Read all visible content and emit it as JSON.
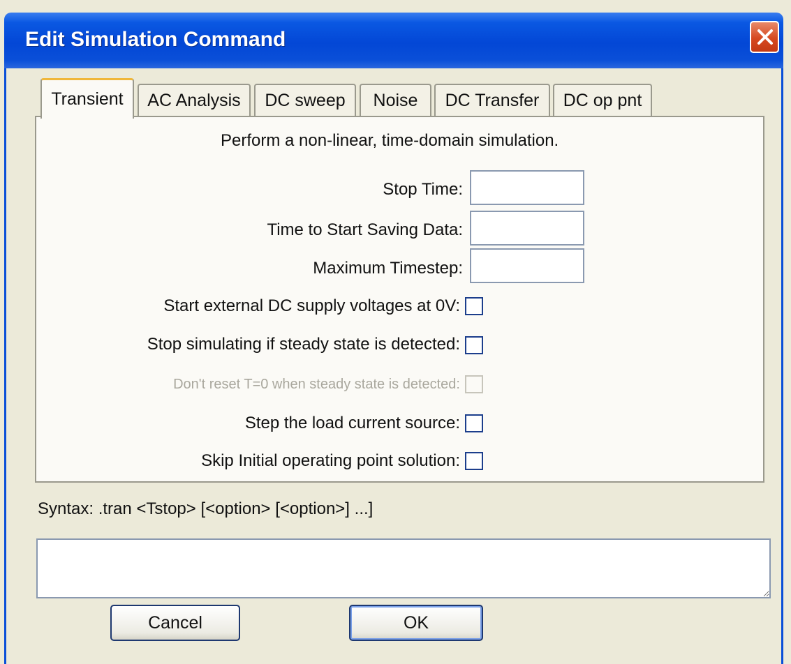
{
  "window": {
    "title": "Edit Simulation Command",
    "close_icon": "close-icon"
  },
  "tabs": [
    {
      "label": "Transient",
      "active": true
    },
    {
      "label": "AC Analysis",
      "active": false
    },
    {
      "label": "DC sweep",
      "active": false
    },
    {
      "label": "Noise",
      "active": false
    },
    {
      "label": "DC Transfer",
      "active": false
    },
    {
      "label": "DC op pnt",
      "active": false
    }
  ],
  "transient": {
    "description": "Perform a non-linear, time-domain simulation.",
    "fields": [
      {
        "label": "Stop Time:",
        "value": ""
      },
      {
        "label": "Time to Start Saving Data:",
        "value": ""
      },
      {
        "label": "Maximum Timestep:",
        "value": ""
      }
    ],
    "checkboxes": [
      {
        "label": "Start external DC supply voltages at 0V:",
        "checked": false,
        "enabled": true
      },
      {
        "label": "Stop simulating if steady state is detected:",
        "checked": false,
        "enabled": true
      },
      {
        "label": "Don't reset T=0 when steady state is detected:",
        "checked": false,
        "enabled": false
      },
      {
        "label": "Step the load current source:",
        "checked": false,
        "enabled": true
      },
      {
        "label": "Skip Initial operating point solution:",
        "checked": false,
        "enabled": true
      }
    ]
  },
  "syntax": "Syntax:  .tran <Tstop> [<option> [<option>] ...]",
  "command_text": "",
  "buttons": {
    "cancel": "Cancel",
    "ok": "OK"
  },
  "colors": {
    "titlebar": "#0347d6",
    "close_button": "#d6481f",
    "active_tab_accent": "#f0b73a",
    "dialog_background": "#ecead9"
  }
}
